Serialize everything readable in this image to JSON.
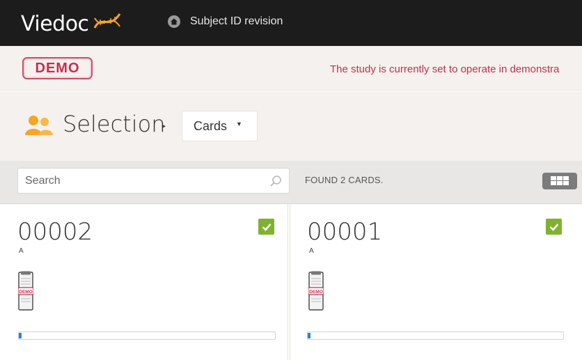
{
  "header": {
    "logo_text": "Viedoc",
    "nav_title": "Subject ID revision"
  },
  "demo": {
    "badge": "DEMO",
    "message": "The study is currently set to operate in demonstra"
  },
  "selection": {
    "title": "Selection",
    "view_selected": "Cards"
  },
  "toolbar": {
    "search_placeholder": "Search",
    "found_text": "FOUND 2 CARDS."
  },
  "cards": [
    {
      "id": "00002",
      "site": "A",
      "checked": true,
      "doc_label": "DEMO",
      "progress": 0.01
    },
    {
      "id": "00001",
      "site": "A",
      "checked": true,
      "doc_label": "DEMO",
      "progress": 0.01
    }
  ],
  "colors": {
    "topbar": "#1c1c1c",
    "demo_accent": "#c2304f",
    "check_green": "#7fb22f",
    "progress_blue": "#2a83d8",
    "selection_icon": "#f5a623"
  },
  "icons": {
    "logo": "dna-logo-icon",
    "home": "home-icon",
    "selection": "users-icon",
    "search": "search-icon",
    "grid": "grid-view-icon",
    "check": "check-icon",
    "document": "clipboard-document-icon"
  }
}
